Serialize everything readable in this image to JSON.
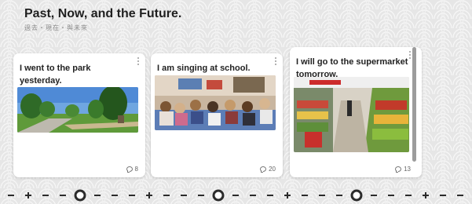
{
  "header": {
    "title": "Past, Now, and the Future.",
    "subtitle": "過去・現在・與未來"
  },
  "cards": [
    {
      "text": "I went to the park yesterday.",
      "comment_count": "8",
      "image": "park-photo"
    },
    {
      "text": "I am singing at school.",
      "comment_count": "20",
      "image": "classroom-photo"
    },
    {
      "text": "I will go to the supermarket tomorrow.",
      "comment_count": "13",
      "image": "supermarket-photo"
    }
  ],
  "colors": {
    "background": "#e9e9e9",
    "card": "#ffffff",
    "timeline_mark": "#2b2b2b"
  },
  "timeline": {
    "markers": [
      "-",
      "+",
      "-",
      "-",
      "●",
      "-",
      "-",
      "-",
      "+",
      "-",
      "-",
      "-",
      "●",
      "-",
      "-",
      "-",
      "+",
      "-",
      "-",
      "-",
      "●",
      "-",
      "-",
      "-",
      "+",
      "-",
      "-"
    ]
  }
}
